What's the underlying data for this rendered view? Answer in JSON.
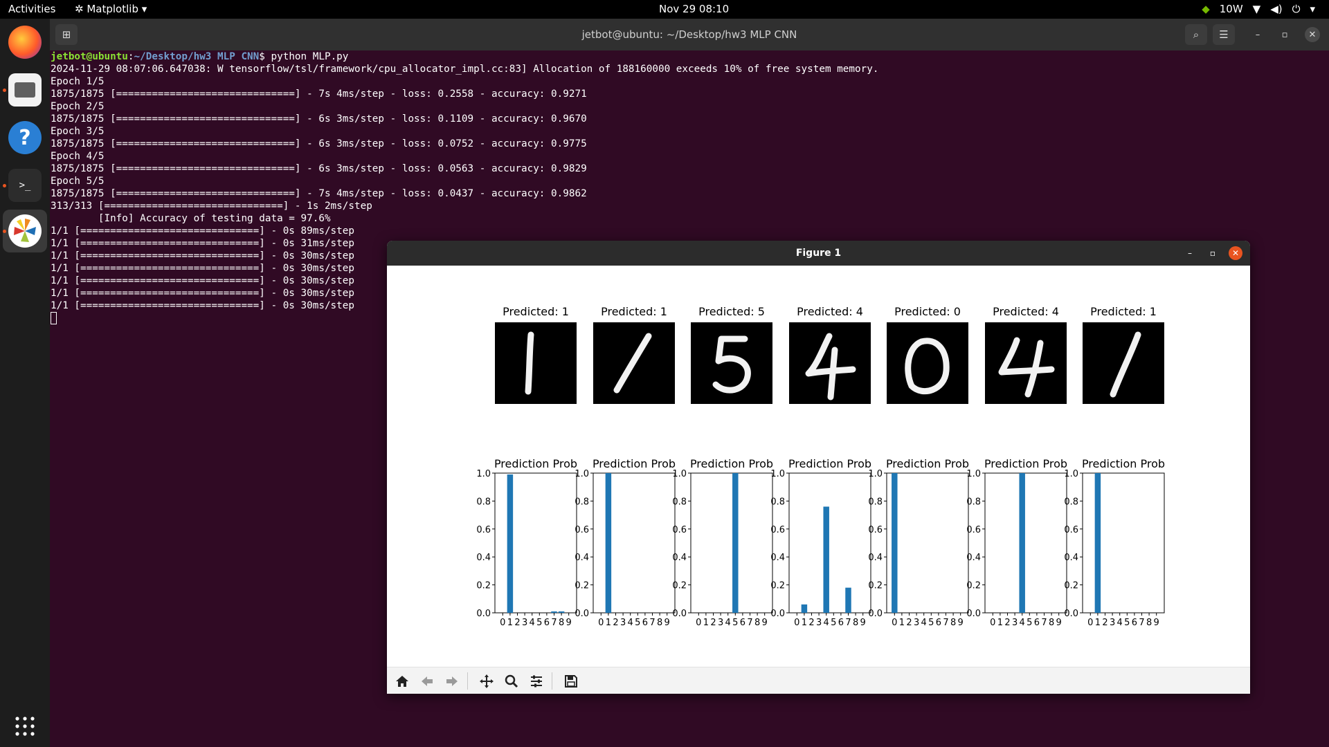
{
  "topbar": {
    "activities": "Activities",
    "app_menu": "Matplotlib",
    "clock": "Nov 29  08:10",
    "power": "10W"
  },
  "dock": {
    "apps": [
      "firefox-icon",
      "files-icon",
      "help-icon",
      "terminal-icon",
      "matplotlib-icon",
      "app-grid-icon"
    ]
  },
  "terminal": {
    "title": "jetbot@ubuntu: ~/Desktop/hw3 MLP CNN",
    "prompt_user": "jetbot@ubuntu",
    "prompt_path": "~/Desktop/hw3 MLP CNN",
    "command": "$ python MLP.py",
    "lines": [
      "2024-11-29 08:07:06.647038: W tensorflow/tsl/framework/cpu_allocator_impl.cc:83] Allocation of 188160000 exceeds 10% of free system memory.",
      "Epoch 1/5",
      "1875/1875 [==============================] - 7s 4ms/step - loss: 0.2558 - accuracy: 0.9271",
      "Epoch 2/5",
      "1875/1875 [==============================] - 6s 3ms/step - loss: 0.1109 - accuracy: 0.9670",
      "Epoch 3/5",
      "1875/1875 [==============================] - 6s 3ms/step - loss: 0.0752 - accuracy: 0.9775",
      "Epoch 4/5",
      "1875/1875 [==============================] - 6s 3ms/step - loss: 0.0563 - accuracy: 0.9829",
      "Epoch 5/5",
      "1875/1875 [==============================] - 7s 4ms/step - loss: 0.0437 - accuracy: 0.9862",
      "313/313 [==============================] - 1s 2ms/step",
      "        [Info] Accuracy of testing data = 97.6%",
      "1/1 [==============================] - 0s 89ms/step",
      "1/1 [==============================] - 0s 31ms/step",
      "1/1 [==============================] - 0s 30ms/step",
      "1/1 [==============================] - 0s 30ms/step",
      "1/1 [==============================] - 0s 30ms/step",
      "1/1 [==============================] - 0s 30ms/step",
      "1/1 [==============================] - 0s 30ms/step"
    ]
  },
  "figure": {
    "title": "Figure 1",
    "toolbar": [
      "home-icon",
      "back-icon",
      "forward-icon",
      "pan-icon",
      "zoom-icon",
      "configure-icon",
      "save-icon"
    ]
  },
  "chart_data": [
    {
      "type": "bar",
      "title": "Prediction Prob",
      "image_title": "Predicted: 1",
      "categories": [
        "0",
        "1",
        "2",
        "3",
        "4",
        "5",
        "6",
        "7",
        "8",
        "9"
      ],
      "values": [
        0,
        0.99,
        0,
        0,
        0,
        0,
        0,
        0.01,
        0.01,
        0
      ],
      "ylim": [
        0,
        1.0
      ],
      "yticks": [
        "0.0",
        "0.2",
        "0.4",
        "0.6",
        "0.8",
        "1.0"
      ]
    },
    {
      "type": "bar",
      "title": "Prediction Prob",
      "image_title": "Predicted: 1",
      "categories": [
        "0",
        "1",
        "2",
        "3",
        "4",
        "5",
        "6",
        "7",
        "8",
        "9"
      ],
      "values": [
        0,
        1.0,
        0,
        0,
        0,
        0,
        0,
        0,
        0,
        0
      ],
      "ylim": [
        0,
        1.0
      ],
      "yticks": [
        "0.0",
        "0.2",
        "0.4",
        "0.6",
        "0.8",
        "1.0"
      ]
    },
    {
      "type": "bar",
      "title": "Prediction Prob",
      "image_title": "Predicted: 5",
      "categories": [
        "0",
        "1",
        "2",
        "3",
        "4",
        "5",
        "6",
        "7",
        "8",
        "9"
      ],
      "values": [
        0,
        0,
        0,
        0,
        0,
        1.0,
        0,
        0,
        0,
        0
      ],
      "ylim": [
        0,
        1.0
      ],
      "yticks": [
        "0.0",
        "0.2",
        "0.4",
        "0.6",
        "0.8",
        "1.0"
      ]
    },
    {
      "type": "bar",
      "title": "Prediction Prob",
      "image_title": "Predicted: 4",
      "categories": [
        "0",
        "1",
        "2",
        "3",
        "4",
        "5",
        "6",
        "7",
        "8",
        "9"
      ],
      "values": [
        0,
        0.06,
        0,
        0,
        0.76,
        0,
        0,
        0.18,
        0,
        0
      ],
      "ylim": [
        0,
        1.0
      ],
      "yticks": [
        "0.0",
        "0.2",
        "0.4",
        "0.6",
        "0.8",
        "1.0"
      ]
    },
    {
      "type": "bar",
      "title": "Prediction Prob",
      "image_title": "Predicted: 0",
      "categories": [
        "0",
        "1",
        "2",
        "3",
        "4",
        "5",
        "6",
        "7",
        "8",
        "9"
      ],
      "values": [
        1.0,
        0,
        0,
        0,
        0,
        0,
        0,
        0,
        0,
        0
      ],
      "ylim": [
        0,
        1.0
      ],
      "yticks": [
        "0.0",
        "0.2",
        "0.4",
        "0.6",
        "0.8",
        "1.0"
      ]
    },
    {
      "type": "bar",
      "title": "Prediction Prob",
      "image_title": "Predicted: 4",
      "categories": [
        "0",
        "1",
        "2",
        "3",
        "4",
        "5",
        "6",
        "7",
        "8",
        "9"
      ],
      "values": [
        0,
        0,
        0,
        0,
        1.0,
        0,
        0,
        0,
        0,
        0
      ],
      "ylim": [
        0,
        1.0
      ],
      "yticks": [
        "0.0",
        "0.2",
        "0.4",
        "0.6",
        "0.8",
        "1.0"
      ]
    },
    {
      "type": "bar",
      "title": "Prediction Prob",
      "image_title": "Predicted: 1",
      "categories": [
        "0",
        "1",
        "2",
        "3",
        "4",
        "5",
        "6",
        "7",
        "8",
        "9"
      ],
      "values": [
        0,
        1.0,
        0,
        0,
        0,
        0,
        0,
        0,
        0,
        0
      ],
      "ylim": [
        0,
        1.0
      ],
      "yticks": [
        "0.0",
        "0.2",
        "0.4",
        "0.6",
        "0.8",
        "1.0"
      ]
    }
  ]
}
